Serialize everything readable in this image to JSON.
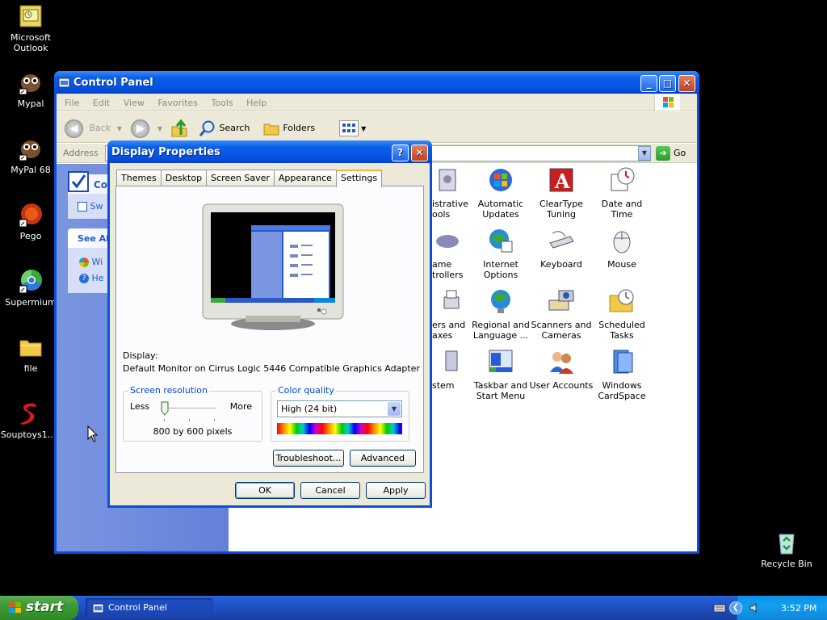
{
  "desktop_icons": [
    {
      "label": "Microsoft Outlook",
      "icon": "outlook-icon"
    },
    {
      "label": "Mypal",
      "icon": "mypal-icon"
    },
    {
      "label": "MyPal 68",
      "icon": "mypal68-icon"
    },
    {
      "label": "Pego",
      "icon": "pego-icon"
    },
    {
      "label": "Supermium",
      "icon": "supermium-icon"
    },
    {
      "label": "file",
      "icon": "folder-icon"
    },
    {
      "label": "Souptoys1...",
      "icon": "souptoys-icon"
    },
    {
      "label": "Recycle Bin",
      "icon": "recycle-bin-icon"
    }
  ],
  "control_panel": {
    "title": "Control Panel",
    "menu": [
      "File",
      "Edit",
      "View",
      "Favorites",
      "Tools",
      "Help"
    ],
    "toolbar": {
      "back": "Back",
      "search": "Search",
      "folders": "Folders"
    },
    "address_label": "Address",
    "go_label": "Go",
    "sidebar": {
      "box1_title": "Co",
      "box1_item": "Sw",
      "box2_title": "See Al",
      "box2_items": [
        "Wi",
        "He"
      ]
    },
    "items": [
      {
        "label": "Administrative Tools",
        "visible_label": "istrative\nools",
        "icon": "administrative-tools-icon"
      },
      {
        "label": "Automatic Updates",
        "icon": "automatic-updates-icon"
      },
      {
        "label": "ClearType Tuning",
        "icon": "cleartype-tuning-icon"
      },
      {
        "label": "Date and Time",
        "icon": "date-time-icon"
      },
      {
        "label": "Game Controllers",
        "visible_label": "ame\ntrollers",
        "icon": "game-controllers-icon"
      },
      {
        "label": "Internet Options",
        "icon": "internet-options-icon"
      },
      {
        "label": "Keyboard",
        "icon": "keyboard-icon"
      },
      {
        "label": "Mouse",
        "icon": "mouse-icon"
      },
      {
        "label": "Printers and Faxes",
        "visible_label": "ers and\naxes",
        "icon": "printers-faxes-icon"
      },
      {
        "label": "Regional and Language ...",
        "icon": "regional-language-icon"
      },
      {
        "label": "Scanners and Cameras",
        "icon": "scanners-cameras-icon"
      },
      {
        "label": "Scheduled Tasks",
        "icon": "scheduled-tasks-icon"
      },
      {
        "label": "System",
        "visible_label": "stem",
        "icon": "system-icon"
      },
      {
        "label": "Taskbar and Start Menu",
        "icon": "taskbar-startmenu-icon"
      },
      {
        "label": "User Accounts",
        "icon": "user-accounts-icon"
      },
      {
        "label": "Windows CardSpace",
        "icon": "windows-cardspace-icon"
      }
    ]
  },
  "display_properties": {
    "title": "Display Properties",
    "tabs": [
      "Themes",
      "Desktop",
      "Screen Saver",
      "Appearance",
      "Settings"
    ],
    "active_tab": "Settings",
    "display_label": "Display:",
    "display_value": "Default Monitor on Cirrus Logic 5446 Compatible Graphics Adapter",
    "screen_resolution": {
      "legend": "Screen resolution",
      "less": "Less",
      "more": "More",
      "value": "800 by 600 pixels",
      "slider_fraction": 0
    },
    "color_quality": {
      "legend": "Color quality",
      "selected": "High (24 bit)"
    },
    "buttons": {
      "troubleshoot": "Troubleshoot...",
      "advanced": "Advanced",
      "ok": "OK",
      "cancel": "Cancel",
      "apply": "Apply"
    }
  },
  "taskbar": {
    "start_label": "start",
    "task_button": "Control Panel",
    "clock": "3:52 PM"
  }
}
